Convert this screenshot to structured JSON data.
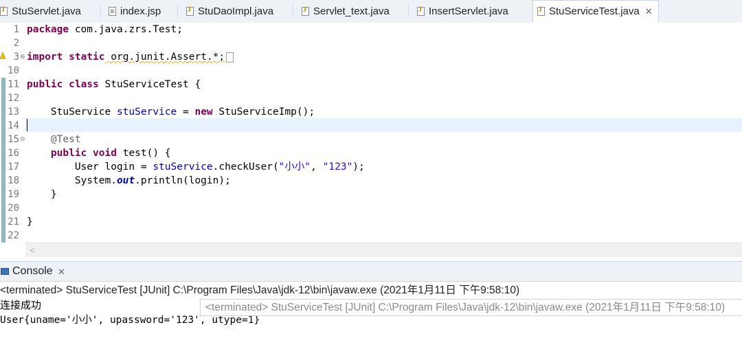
{
  "tabs": [
    {
      "label": "StuServlet.java",
      "icon": "java-file-icon"
    },
    {
      "label": "index.jsp",
      "icon": "jsp-file-icon"
    },
    {
      "label": "StuDaoImpl.java",
      "icon": "java-file-icon"
    },
    {
      "label": "Servlet_text.java",
      "icon": "java-file-icon"
    },
    {
      "label": "InsertServlet.java",
      "icon": "java-file-icon"
    },
    {
      "label": "StuServiceTest.java",
      "icon": "java-file-icon",
      "active": true,
      "close": "✕"
    }
  ],
  "editor": {
    "line_numbers": [
      "1",
      "2",
      "3",
      "10",
      "11",
      "12",
      "13",
      "14",
      "15",
      "16",
      "17",
      "18",
      "19",
      "20",
      "21",
      "22"
    ],
    "code": {
      "l1_kw": "package",
      "l1_rest": " com.java.zrs.Test;",
      "l3_kw1": "import",
      "l3_kw2": "static",
      "l3_rest": " org.junit.Assert.*;",
      "l11_kw1": "public",
      "l11_kw2": "class",
      "l11_rest": " StuServiceTest {",
      "l13_type": "    StuService ",
      "l13_fld": "stuService",
      "l13_eq": " = ",
      "l13_kw": "new",
      "l13_rest": " StuServiceImp();",
      "l15_ann": "    @Test",
      "l16_kw1": "    public",
      "l16_kw2": "void",
      "l16_rest": " test() {",
      "l17_a": "        User login = ",
      "l17_fld": "stuService",
      "l17_b": ".checkUser(",
      "l17_s1": "\"小小\"",
      "l17_c": ", ",
      "l17_s2": "\"123\"",
      "l17_d": ");",
      "l18_a": "        System.",
      "l18_fld": "out",
      "l18_b": ".println(login);",
      "l19": "    }",
      "l21": "}"
    },
    "hscroll_arrow": "<"
  },
  "console": {
    "title": "Console",
    "close": "✕",
    "terminated": "<terminated> StuServiceTest [JUnit] C:\\Program Files\\Java\\jdk-12\\bin\\javaw.exe (2021年1月11日 下午9:58:10)",
    "output": [
      "连接成功",
      "User{uname='小小', upassword='123', utype=1}"
    ],
    "tooltip": "<terminated> StuServiceTest [JUnit] C:\\Program Files\\Java\\jdk-12\\bin\\javaw.exe (2021年1月11日 下午9:58:10)"
  }
}
